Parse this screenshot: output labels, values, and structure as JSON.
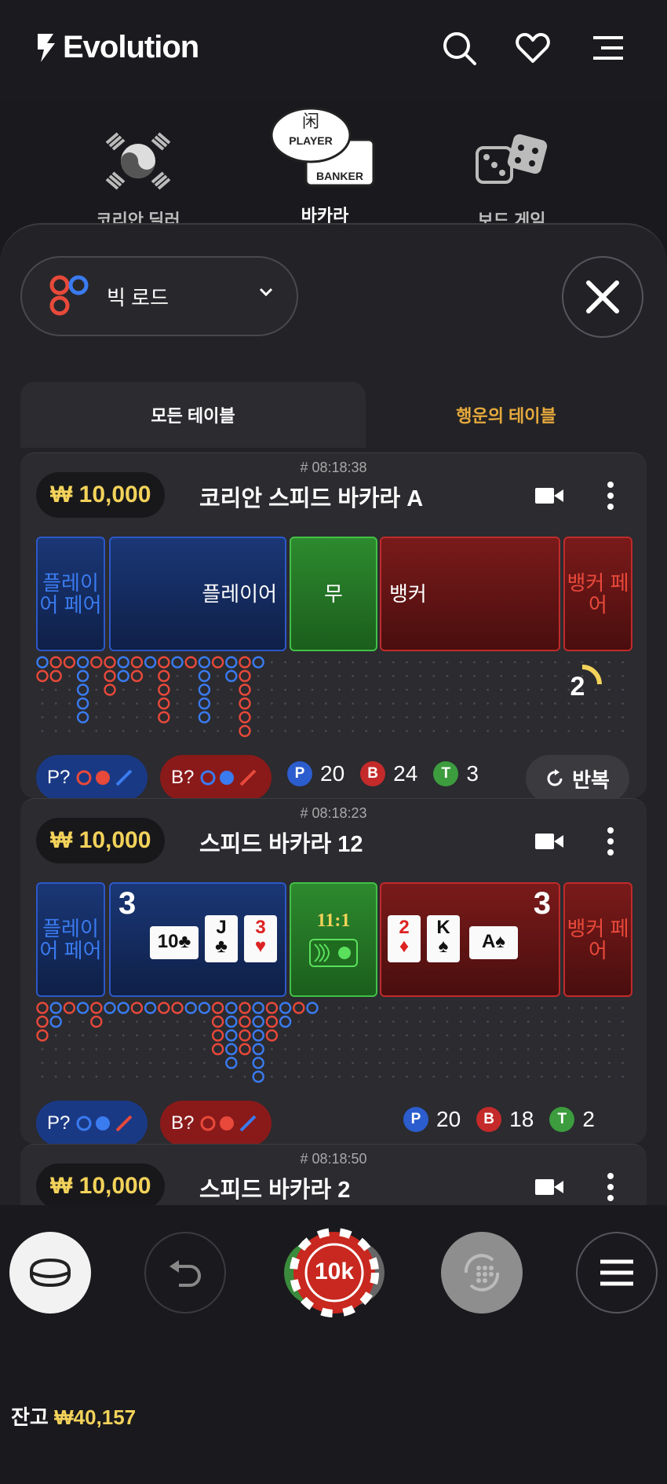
{
  "header": {
    "brand": "Evolution"
  },
  "categories": [
    {
      "label": "코리안 딜러",
      "icon": "korean-flag-icon"
    },
    {
      "label": "바카라",
      "icon": "baccarat-icon",
      "player_tag": "PLAYER",
      "banker_tag": "BANKER"
    },
    {
      "label": "보드 게임",
      "icon": "dice-icon"
    }
  ],
  "road_selector": {
    "label": "빅 로드"
  },
  "tabs": {
    "all": "모든 테이블",
    "lucky": "행운의 테이블"
  },
  "tables": [
    {
      "timestamp": "# 08:18:38",
      "limit": "₩ 10,000",
      "name": "코리안 스피드 바카라 A",
      "bets": {
        "player_pair": "플레이어 페어",
        "player": "플레이어",
        "tie": "무",
        "banker": "뱅커",
        "banker_pair": "뱅커 페어"
      },
      "countdown": "2",
      "predict_player": "P?",
      "predict_banker": "B?",
      "stats": {
        "p": "20",
        "b": "24",
        "t": "3"
      },
      "repeat_label": "반복"
    },
    {
      "timestamp": "# 08:18:23",
      "limit": "₩ 10,000",
      "name": "스피드 바카라 12",
      "bets": {
        "player_pair": "플레이어 페어",
        "tie_payout": "11:1",
        "banker_pair": "뱅커 페어"
      },
      "player_total": "3",
      "banker_total": "3",
      "player_cards": [
        "10",
        "J",
        "3"
      ],
      "banker_cards": [
        "2",
        "K",
        "A"
      ],
      "predict_player": "P?",
      "predict_banker": "B?",
      "stats": {
        "p": "20",
        "b": "18",
        "t": "2"
      }
    },
    {
      "timestamp": "# 08:18:50",
      "limit": "₩ 10,000",
      "name": "스피드 바카라 2"
    }
  ],
  "stat_letters": {
    "p": "P",
    "b": "B",
    "t": "T"
  },
  "chip": {
    "value": "10k"
  },
  "balance": {
    "label": "잔고",
    "amount": "₩40,157"
  }
}
